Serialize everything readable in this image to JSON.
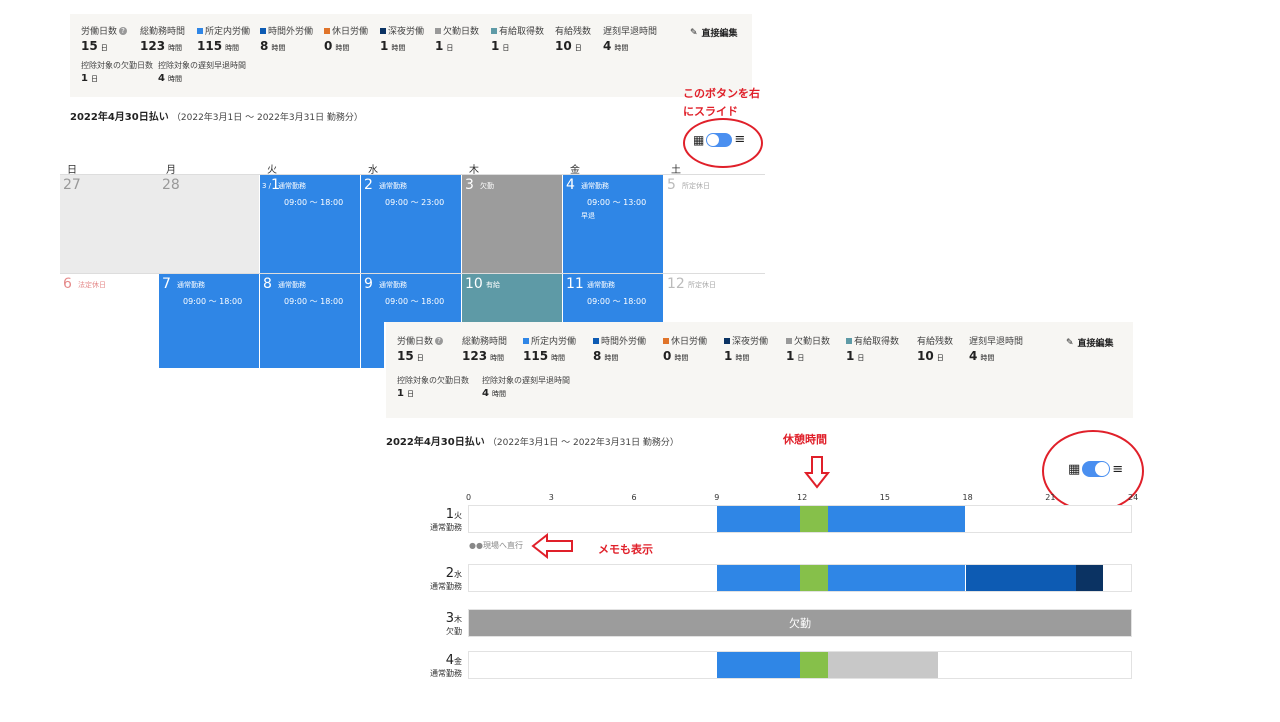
{
  "summary": {
    "stats": [
      {
        "label": "労働日数",
        "value": "15",
        "unit": "日",
        "help": "?"
      },
      {
        "label": "総勤務時間",
        "value": "123",
        "unit": "時間"
      },
      {
        "label": "所定内労働",
        "value": "115",
        "unit": "時間",
        "color": "#2f86e6"
      },
      {
        "label": "時間外労働",
        "value": "8",
        "unit": "時間",
        "color": "#0d5bb3"
      },
      {
        "label": "休日労働",
        "value": "0",
        "unit": "時間",
        "color": "#e0742a"
      },
      {
        "label": "深夜労働",
        "value": "1",
        "unit": "時間",
        "color": "#0b3363"
      },
      {
        "label": "欠勤日数",
        "value": "1",
        "unit": "日",
        "color": "#999999"
      },
      {
        "label": "有給取得数",
        "value": "1",
        "unit": "日",
        "color": "#5e9aa6"
      },
      {
        "label": "有給残数",
        "value": "10",
        "unit": "日"
      },
      {
        "label": "遅刻早退時間",
        "value": "4",
        "unit": "時間"
      }
    ],
    "sub_stats": [
      {
        "label": "控除対象の欠勤日数",
        "value": "1",
        "unit": "日"
      },
      {
        "label": "控除対象の遅刻早退時間",
        "value": "4",
        "unit": "時間"
      }
    ],
    "edit_label": "直接編集"
  },
  "pay": {
    "title": "2022年4月30日払い",
    "period": "（2022年3月1日 ～ 2022年3月31日 勤務分）"
  },
  "calendar": {
    "weekdays": [
      "日",
      "月",
      "火",
      "水",
      "木",
      "金",
      "土"
    ],
    "week1": [
      {
        "num": "27",
        "kind": "other"
      },
      {
        "num": "28",
        "kind": "other"
      },
      {
        "num": "1",
        "prefix": "3 /",
        "kind": "work",
        "tag": "通常勤務",
        "time": "09:00 ～ 18:00"
      },
      {
        "num": "2",
        "kind": "work",
        "tag": "通常勤務",
        "time": "09:00 ～ 23:00"
      },
      {
        "num": "3",
        "kind": "absent",
        "tag": "欠勤"
      },
      {
        "num": "4",
        "kind": "work",
        "tag": "通常勤務",
        "time": "09:00 ～ 13:00",
        "note": "早退"
      },
      {
        "num": "5",
        "kind": "holiday",
        "tag": "所定休日"
      }
    ],
    "week2": [
      {
        "num": "6",
        "kind": "legal",
        "tag": "法定休日"
      },
      {
        "num": "7",
        "kind": "work",
        "tag": "通常勤務",
        "time": "09:00 ～ 18:00"
      },
      {
        "num": "8",
        "kind": "work",
        "tag": "通常勤務",
        "time": "09:00 ～ 18:00"
      },
      {
        "num": "9",
        "kind": "work",
        "tag": "通常勤務",
        "time": "09:00 ～ 18:00"
      },
      {
        "num": "10",
        "kind": "paid",
        "tag": "有給"
      },
      {
        "num": "11",
        "kind": "work",
        "tag": "通常勤務",
        "time": "09:00 ～ 18:00"
      },
      {
        "num": "12",
        "kind": "holiday",
        "tag": "所定休日"
      }
    ]
  },
  "annotations": {
    "slide_line1": "このボタンを右",
    "slide_line2": "にスライド",
    "break_time": "休憩時間",
    "memo_show": "メモも表示"
  },
  "timeline": {
    "axis": [
      "0",
      "3",
      "6",
      "9",
      "12",
      "15",
      "18",
      "21",
      "24"
    ],
    "memo": "●●現場へ直行",
    "rows": [
      {
        "day": "1",
        "weekday": "火",
        "kind": "通常勤務",
        "segments": [
          {
            "from": 9,
            "to": 12,
            "color": "#2f86e6"
          },
          {
            "from": 12,
            "to": 13,
            "color": "#86c04a"
          },
          {
            "from": 13,
            "to": 18,
            "color": "#2f86e6"
          }
        ]
      },
      {
        "day": "2",
        "weekday": "水",
        "kind": "通常勤務",
        "segments": [
          {
            "from": 9,
            "to": 12,
            "color": "#2f86e6"
          },
          {
            "from": 12,
            "to": 13,
            "color": "#86c04a"
          },
          {
            "from": 13,
            "to": 18,
            "color": "#2f86e6"
          },
          {
            "from": 18,
            "to": 22,
            "color": "#0d5bb3"
          },
          {
            "from": 22,
            "to": 23,
            "color": "#0b3363"
          }
        ]
      },
      {
        "day": "3",
        "weekday": "木",
        "kind": "欠勤",
        "full_label": "欠勤",
        "segments": [
          {
            "from": 0,
            "to": 24,
            "color": "#9c9c9c"
          }
        ]
      },
      {
        "day": "4",
        "weekday": "金",
        "kind": "通常勤務",
        "segments": [
          {
            "from": 9,
            "to": 12,
            "color": "#2f86e6"
          },
          {
            "from": 12,
            "to": 13,
            "color": "#86c04a"
          },
          {
            "from": 13,
            "to": 17,
            "color": "#c8c8c8"
          }
        ]
      }
    ]
  }
}
